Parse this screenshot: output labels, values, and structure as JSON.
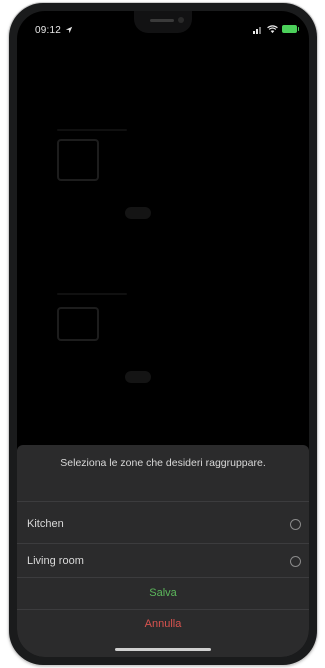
{
  "status_bar": {
    "time": "09:12",
    "location_icon": "location-arrow-icon",
    "signal_icon": "cellular-signal-icon",
    "wifi_icon": "wifi-icon",
    "battery_icon": "battery-icon",
    "battery_color": "#4bd05a"
  },
  "sheet": {
    "title": "Seleziona le zone che desideri raggruppare.",
    "options": [
      {
        "label": "Kitchen",
        "selected": false
      },
      {
        "label": "Living room",
        "selected": false
      }
    ],
    "save_label": "Salva",
    "cancel_label": "Annulla",
    "save_color": "#5cb85c",
    "cancel_color": "#d9534f"
  }
}
